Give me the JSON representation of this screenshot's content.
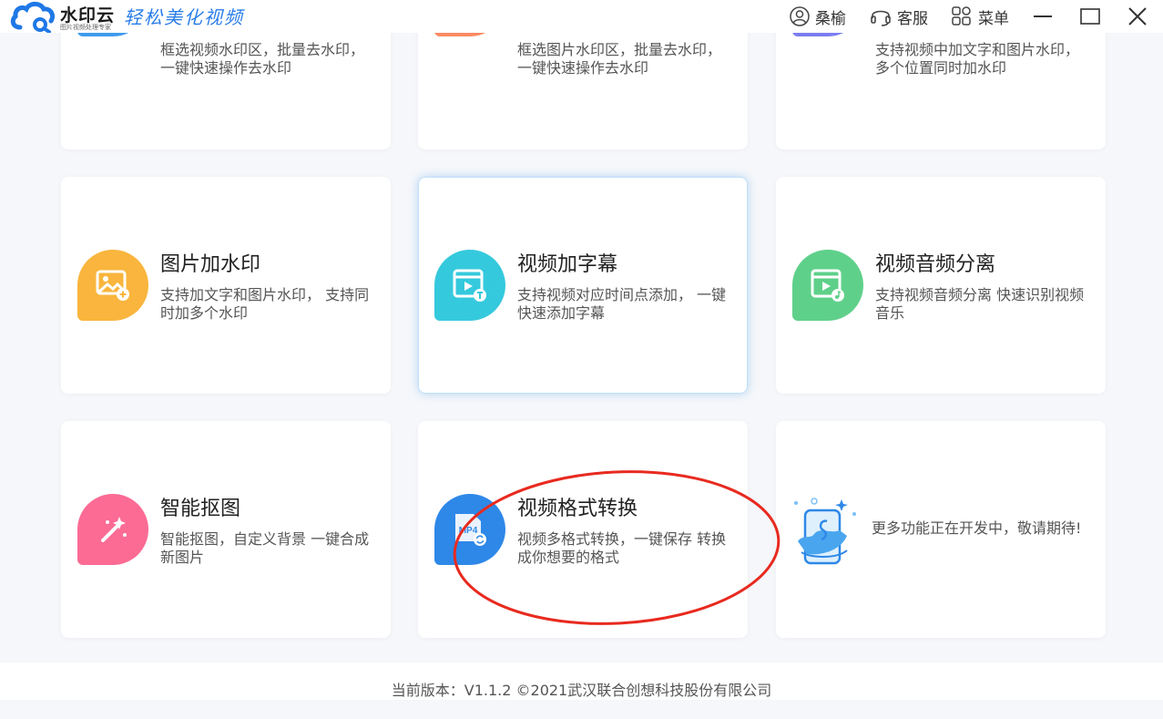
{
  "app": {
    "name": "水印云",
    "subtitle": "图片视频处理专家",
    "slogan": "轻松美化视频"
  },
  "toolbar": {
    "user": "桑榆",
    "service": "客服",
    "menu": "菜单"
  },
  "top_row": [
    {
      "desc": "框选视频水印区，批量去水印， 一键快速操作去水印",
      "icon": "video-remove-watermark-icon",
      "color": "#3d9bec"
    },
    {
      "desc": "框选图片水印区，批量去水印， 一键快速操作去水印",
      "icon": "image-remove-watermark-icon",
      "color": "#f98a63"
    },
    {
      "desc": "支持视频中加文字和图片水印，多个位置同时加水印",
      "icon": "video-add-watermark-icon",
      "color": "#7b7cf0"
    }
  ],
  "cards": [
    {
      "title": "图片加水印",
      "desc": "支持加文字和图片水印， 支持同时加多个水印",
      "icon": "image-watermark-icon",
      "color": "#f9b53d"
    },
    {
      "title": "视频加字幕",
      "desc": "支持视频对应时间点添加， 一键快速添加字幕",
      "icon": "video-subtitle-icon",
      "color": "#35c9dd"
    },
    {
      "title": "视频音频分离",
      "desc": "支持视频音频分离 快速识别视频音乐",
      "icon": "audio-separate-icon",
      "color": "#5fd08a"
    },
    {
      "title": "智能抠图",
      "desc": "智能抠图，自定义背景 一键合成新图片",
      "icon": "magic-wand-icon",
      "color": "#fb6b94"
    },
    {
      "title": "视频格式转换",
      "desc": "视频多格式转换，一键保存 转换成你想要的格式",
      "icon": "mp4-convert-icon",
      "color": "#2e88e8",
      "icon_text": "MP4"
    }
  ],
  "coming_soon": {
    "text": "更多功能正在开发中，敬请期待!"
  },
  "footer": {
    "text": "当前版本：V1.1.2 ©2021武汉联合创想科技股份有限公司"
  }
}
